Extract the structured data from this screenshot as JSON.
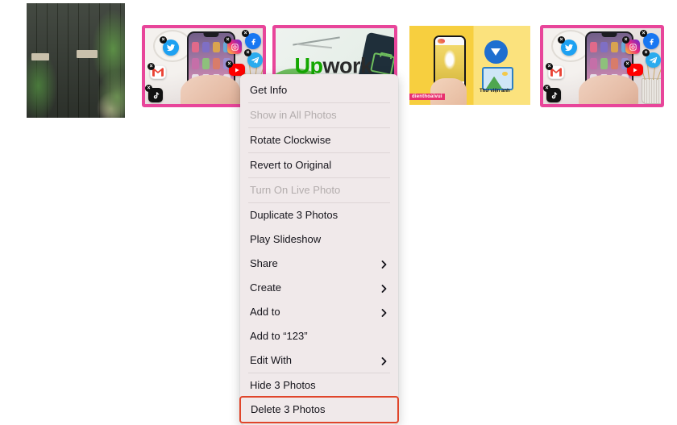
{
  "window": {
    "background": "#ffffff",
    "selection_border_color": "#e8459a",
    "menu_background": "#f0e9ea",
    "highlight_color": "#e0452a"
  },
  "thumbnails": [
    {
      "name": "photo-dark-grid-wall",
      "selected": false,
      "alt": "Dark metal grid wall with potted plants"
    },
    {
      "name": "photo-social-apps-phone-1",
      "selected": true,
      "alt": "Hand holding a phone surrounded by social app icon stickers",
      "stickers": [
        "twitter",
        "instagram",
        "facebook",
        "telegram",
        "youtube",
        "gmail",
        "tiktok"
      ]
    },
    {
      "name": "photo-upwork",
      "selected": true,
      "alt": "Upwork logo on a light green desk background",
      "wordmark_up": "Up",
      "wordmark_work": "work"
    },
    {
      "name": "photo-yellow-gallery",
      "selected": false,
      "alt": "Hand holding phone on yellow background with download and gallery icons",
      "caption": "Thư viện ảnh",
      "watermark": "dienthoaivui"
    },
    {
      "name": "photo-social-apps-phone-2",
      "selected": true,
      "alt": "Hand holding a phone surrounded by social app icon stickers",
      "stickers": [
        "twitter",
        "instagram",
        "facebook",
        "telegram",
        "youtube",
        "gmail",
        "tiktok"
      ]
    }
  ],
  "context_menu": {
    "groups": [
      {
        "items": [
          {
            "label": "Get Info",
            "disabled": false,
            "submenu": false
          },
          {
            "label": "Show in All Photos",
            "disabled": true,
            "submenu": false
          },
          {
            "label": "Rotate Clockwise",
            "disabled": false,
            "submenu": false
          },
          {
            "label": "Revert to Original",
            "disabled": false,
            "submenu": false
          },
          {
            "label": "Turn On Live Photo",
            "disabled": true,
            "submenu": false
          }
        ]
      },
      {
        "items": [
          {
            "label": "Duplicate 3 Photos",
            "disabled": false,
            "submenu": false
          },
          {
            "label": "Play Slideshow",
            "disabled": false,
            "submenu": false
          },
          {
            "label": "Share",
            "disabled": false,
            "submenu": true
          },
          {
            "label": "Create",
            "disabled": false,
            "submenu": true
          },
          {
            "label": "Add to",
            "disabled": false,
            "submenu": true
          },
          {
            "label": "Add to “123”",
            "disabled": false,
            "submenu": false
          },
          {
            "label": "Edit With",
            "disabled": false,
            "submenu": true
          }
        ]
      },
      {
        "items": [
          {
            "label": "Hide 3 Photos",
            "disabled": false,
            "submenu": false
          },
          {
            "label": "Delete 3 Photos",
            "disabled": false,
            "submenu": false,
            "highlighted": true
          }
        ]
      }
    ]
  }
}
